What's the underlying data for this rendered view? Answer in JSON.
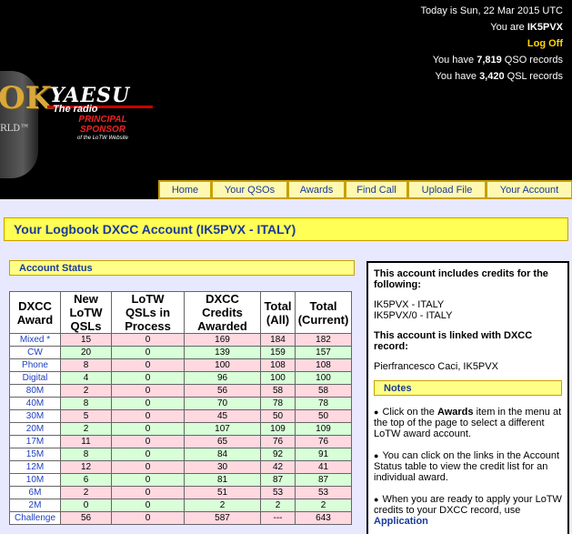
{
  "header": {
    "date_line": "Today is Sun, 22 Mar 2015 UTC",
    "you_are_prefix": "You are ",
    "callsign": "IK5PVX",
    "logoff": "Log Off",
    "qso_prefix": "You have ",
    "qso_count": "7,819",
    "qso_suffix": " QSO records",
    "qsl_prefix": "You have ",
    "qsl_count": "3,420",
    "qsl_suffix": " QSL records"
  },
  "logo": {
    "lotw_letters": "OK",
    "world_text": "RLD™"
  },
  "sponsor": {
    "brand": "YAESU",
    "tagline": "The radio",
    "line1": "PRINCIPAL",
    "line2": "SPONSOR",
    "line3": "of the LoTW Website"
  },
  "nav": {
    "items": [
      {
        "label": "Home",
        "width": 58
      },
      {
        "label": "Your QSOs",
        "width": 84
      },
      {
        "label": "Awards",
        "width": 63
      },
      {
        "label": "Find Call",
        "width": 69
      },
      {
        "label": "Upload File",
        "width": 86
      },
      {
        "label": "Your Account",
        "width": 95
      }
    ]
  },
  "page": {
    "title": "Your Logbook DXCC Account (IK5PVX - ITALY)"
  },
  "status": {
    "heading": "Account Status",
    "columns": [
      [
        "DXCC",
        "Award"
      ],
      [
        "New",
        "LoTW",
        "QSLs"
      ],
      [
        "LoTW",
        "QSLs in",
        "Process"
      ],
      [
        "DXCC",
        "Credits",
        "Awarded"
      ],
      [
        "Total",
        "(All)"
      ],
      [
        "Total",
        "(Current)"
      ]
    ],
    "rows": [
      {
        "award": "Mixed *",
        "new": "15",
        "process": "0",
        "awarded": "169",
        "all": "184",
        "current": "182",
        "tone": "pink"
      },
      {
        "award": "CW",
        "new": "20",
        "process": "0",
        "awarded": "139",
        "all": "159",
        "current": "157",
        "tone": "green"
      },
      {
        "award": "Phone",
        "new": "8",
        "process": "0",
        "awarded": "100",
        "all": "108",
        "current": "108",
        "tone": "pink"
      },
      {
        "award": "Digital",
        "new": "4",
        "process": "0",
        "awarded": "96",
        "all": "100",
        "current": "100",
        "tone": "green"
      },
      {
        "award": "80M",
        "new": "2",
        "process": "0",
        "awarded": "56",
        "all": "58",
        "current": "58",
        "tone": "pink"
      },
      {
        "award": "40M",
        "new": "8",
        "process": "0",
        "awarded": "70",
        "all": "78",
        "current": "78",
        "tone": "green"
      },
      {
        "award": "30M",
        "new": "5",
        "process": "0",
        "awarded": "45",
        "all": "50",
        "current": "50",
        "tone": "pink"
      },
      {
        "award": "20M",
        "new": "2",
        "process": "0",
        "awarded": "107",
        "all": "109",
        "current": "109",
        "tone": "green"
      },
      {
        "award": "17M",
        "new": "11",
        "process": "0",
        "awarded": "65",
        "all": "76",
        "current": "76",
        "tone": "pink"
      },
      {
        "award": "15M",
        "new": "8",
        "process": "0",
        "awarded": "84",
        "all": "92",
        "current": "91",
        "tone": "green"
      },
      {
        "award": "12M",
        "new": "12",
        "process": "0",
        "awarded": "30",
        "all": "42",
        "current": "41",
        "tone": "pink"
      },
      {
        "award": "10M",
        "new": "6",
        "process": "0",
        "awarded": "81",
        "all": "87",
        "current": "87",
        "tone": "green"
      },
      {
        "award": "6M",
        "new": "2",
        "process": "0",
        "awarded": "51",
        "all": "53",
        "current": "53",
        "tone": "pink"
      },
      {
        "award": "2M",
        "new": "0",
        "process": "0",
        "awarded": "2",
        "all": "2",
        "current": "2",
        "tone": "green"
      },
      {
        "award": "Challenge",
        "new": "56",
        "process": "0",
        "awarded": "587",
        "all": "---",
        "current": "643",
        "tone": "pink"
      }
    ]
  },
  "side": {
    "credits_heading": "This account includes credits for the following:",
    "call1": "IK5PVX - ITALY",
    "call2": "IK5PVX/0 - ITALY",
    "linked_heading": "This account is linked with DXCC record:",
    "linked_record": "Pierfrancesco Caci, IK5PVX",
    "notes_heading": "Notes",
    "note1_pre": "Click on the ",
    "note1_bold": "Awards",
    "note1_post": " item in the menu at the top of the page to select a different LoTW award account.",
    "note2": "You can click on the links in the Account Status table to view the credit list for an individual award.",
    "note3": "When you are ready to apply your LoTW credits to your DXCC record, use",
    "note3_link": "Application"
  }
}
